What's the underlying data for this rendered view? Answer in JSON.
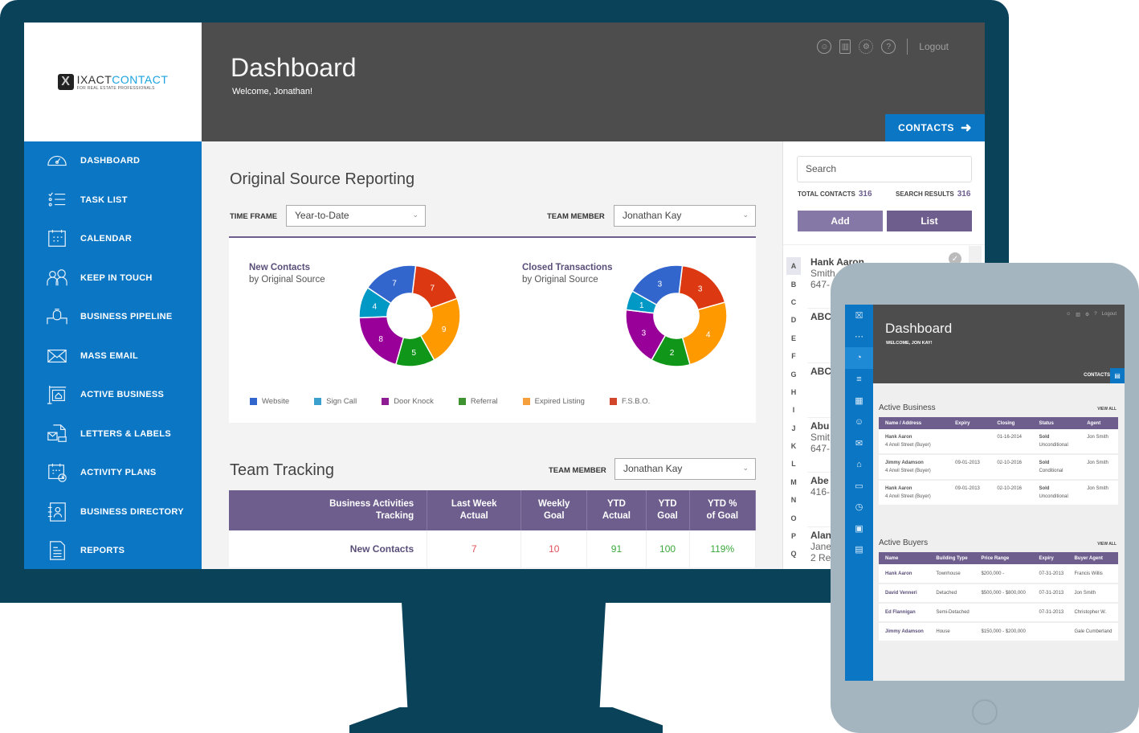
{
  "app": {
    "logo_main": "IXACT",
    "logo_accent": "CONTACT",
    "logo_tagline": "FOR REAL ESTATE PROFESSIONALS"
  },
  "header": {
    "title": "Dashboard",
    "welcome": "Welcome,  Jonathan!",
    "icons": [
      "user-icon",
      "trash-icon",
      "gear-icon",
      "help-icon"
    ],
    "logout": "Logout",
    "contacts_button": "CONTACTS"
  },
  "sidebar": {
    "items": [
      {
        "label": "DASHBOARD",
        "icon": "dashboard-gauge-icon"
      },
      {
        "label": "TASK LIST",
        "icon": "task-list-icon"
      },
      {
        "label": "CALENDAR",
        "icon": "calendar-icon"
      },
      {
        "label": "KEEP IN TOUCH",
        "icon": "people-icon"
      },
      {
        "label": "BUSINESS PIPELINE",
        "icon": "pipeline-icon"
      },
      {
        "label": "MASS EMAIL",
        "icon": "envelope-icon"
      },
      {
        "label": "ACTIVE  BUSINESS",
        "icon": "house-sign-icon"
      },
      {
        "label": "LETTERS & LABELS",
        "icon": "letters-icon"
      },
      {
        "label": "ACTIVITY PLANS",
        "icon": "calendar-clock-icon"
      },
      {
        "label": "BUSINESS DIRECTORY",
        "icon": "directory-icon"
      },
      {
        "label": "REPORTS",
        "icon": "reports-icon"
      }
    ]
  },
  "source_reporting": {
    "title": "Original Source Reporting",
    "time_frame_label": "TIME FRAME",
    "time_frame_value": "Year-to-Date",
    "team_member_label": "TEAM MEMBER",
    "team_member_value": "Jonathan Kay"
  },
  "chart_data": [
    {
      "type": "pie",
      "title": "New Contacts",
      "subtitle": "by Original Source",
      "categories": [
        "Website",
        "Sign Call",
        "Door Knock",
        "Referral",
        "Expired Listing",
        "F.S.B.O."
      ],
      "values": [
        7,
        4,
        8,
        5,
        9,
        7
      ],
      "colors": [
        "#3366cc",
        "#0099c6",
        "#990099",
        "#109618",
        "#ff9900",
        "#dc3912"
      ],
      "legend": "bottom"
    },
    {
      "type": "pie",
      "title": "Closed Transactions",
      "subtitle": "by Original Source",
      "categories": [
        "Website",
        "Sign Call",
        "Door Knock",
        "Referral",
        "Expired Listing",
        "F.S.B.O."
      ],
      "values": [
        3,
        1,
        3,
        2,
        4,
        3
      ],
      "colors": [
        "#3366cc",
        "#0099c6",
        "#990099",
        "#109618",
        "#ff9900",
        "#dc3912"
      ],
      "legend": "bottom"
    }
  ],
  "legend": [
    {
      "label": "Website",
      "color": "#3366cc"
    },
    {
      "label": "Sign Call",
      "color": "#3ca0cf"
    },
    {
      "label": "Door Knock",
      "color": "#8e1d94"
    },
    {
      "label": "Referral",
      "color": "#3f9330"
    },
    {
      "label": "Expired Listing",
      "color": "#f5a03d"
    },
    {
      "label": "F.S.B.O.",
      "color": "#d2472b"
    }
  ],
  "team_tracking": {
    "title": "Team Tracking",
    "team_member_label": "TEAM MEMBER",
    "team_member_value": "Jonathan Kay",
    "columns": [
      [
        "Business Activities",
        "Tracking"
      ],
      [
        "Last Week",
        "Actual"
      ],
      [
        "Weekly",
        "Goal"
      ],
      [
        "YTD",
        "Actual"
      ],
      [
        "YTD",
        "Goal"
      ],
      [
        "YTD %",
        "of Goal"
      ]
    ],
    "rows": [
      {
        "label": "New Contacts",
        "values": [
          "7",
          "10",
          "91",
          "100",
          "119%"
        ],
        "colors": [
          "#e0505a",
          "#e0505a",
          "#3aa83a",
          "#3aa83a",
          "#3aa83a"
        ]
      }
    ]
  },
  "contacts_panel": {
    "search_placeholder": "Search",
    "total_label": "TOTAL CONTACTS",
    "total_value": "316",
    "results_label": "SEARCH RESULTS",
    "results_value": "316",
    "add_button": "Add",
    "list_button": "List",
    "alphabet": [
      "A",
      "B",
      "C",
      "D",
      "E",
      "F",
      "G",
      "H",
      "I",
      "J",
      "K",
      "L",
      "M",
      "N",
      "O",
      "P",
      "Q"
    ],
    "contacts": [
      {
        "name": "Hank Aaron",
        "lines": [
          "Smith",
          "647-"
        ]
      },
      {
        "name": "ABC",
        "lines": [
          "",
          ""
        ]
      },
      {
        "name": "ABC",
        "lines": [
          "",
          ""
        ]
      },
      {
        "name": "Abu",
        "lines": [
          "Smit",
          "647-"
        ]
      },
      {
        "name": "Abe",
        "lines": [
          "416-"
        ]
      },
      {
        "name": "Alan",
        "lines": [
          "Jane",
          "2 Re"
        ]
      }
    ]
  },
  "tablet": {
    "title": "Dashboard",
    "welcome": "WELCOME, JON KAY!",
    "logout": "Logout",
    "contacts": "CONTACTS",
    "active_business": {
      "title": "Active Business",
      "view_all": "VIEW ALL",
      "columns": [
        "Name / Address",
        "Expiry",
        "Closing",
        "Status",
        "Agent"
      ],
      "rows": [
        {
          "name": "Hank Aaron",
          "address": "4 Anvil Street (Buyer)",
          "expiry": "",
          "closing": "01-16-2014",
          "status": "Sold",
          "status_sub": "Unconditional",
          "agent": "Jon Smith"
        },
        {
          "name": "Jimmy Adamson",
          "address": "4 Anvil Street (Buyer)",
          "expiry": "09-01-2013",
          "closing": "02-10-2016",
          "status": "Sold",
          "status_sub": "Conditional",
          "agent": "Jon Smith"
        },
        {
          "name": "Hank Aaron",
          "address": "4 Anvil Street (Buyer)",
          "expiry": "09-01-2013",
          "closing": "02-10-2016",
          "status": "Sold",
          "status_sub": "Unconditional",
          "agent": "Jon Smith"
        }
      ]
    },
    "active_buyers": {
      "title": "Active Buyers",
      "view_all": "VIEW ALL",
      "columns": [
        "Name",
        "Building Type",
        "Price Range",
        "Expiry",
        "Buyer Agent"
      ],
      "rows": [
        {
          "name": "Hank Aaron",
          "type": "Townhouse",
          "price": "$200,000 -",
          "expiry": "07-31-2013",
          "agent": "Francis Willis"
        },
        {
          "name": "David Venneri",
          "type": "Detached",
          "price": "$500,000 - $800,000",
          "expiry": "07-31-2013",
          "agent": "Jon Smith"
        },
        {
          "name": "Ed Flannigan",
          "type": "Semi-Detached",
          "price": "",
          "expiry": "07-31-2013",
          "agent": "Christopher W."
        },
        {
          "name": "Jimmy Adamson",
          "type": "House",
          "price": "$150,000 - $200,000",
          "expiry": "",
          "agent": "Gale Cumberland"
        }
      ]
    }
  }
}
